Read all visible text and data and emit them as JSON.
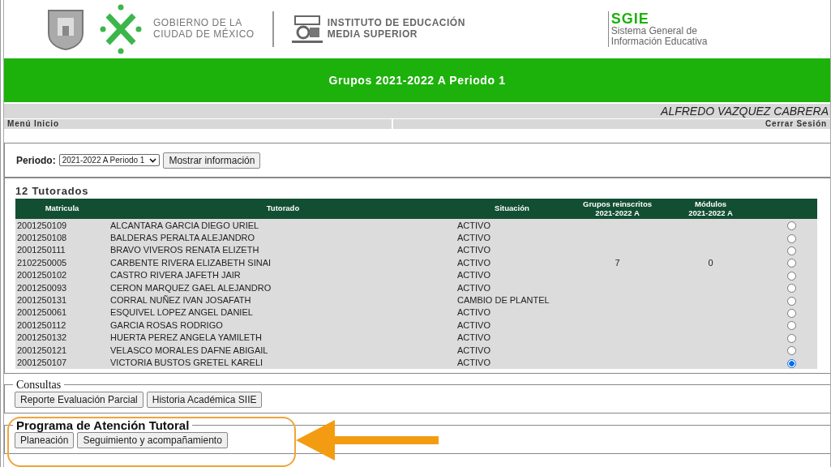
{
  "header": {
    "gov_lines": [
      "GOBIERNO DE LA",
      "CIUDAD DE MÉXICO"
    ],
    "institute_lines": [
      "INSTITUTO DE EDUCACIÓN",
      "MEDIA SUPERIOR"
    ],
    "sgie_title": "SGIE",
    "sgie_lines": [
      "Sistema General de",
      "Información Educativa"
    ]
  },
  "banner": {
    "title": "Grupos 2021-2022 A Periodo 1"
  },
  "user": {
    "name": "ALFREDO VAZQUEZ CABRERA"
  },
  "menu": {
    "left": "Menú Inicio",
    "right": "Cerrar Sesión"
  },
  "period": {
    "label": "Periodo:",
    "value": "2021-2022 A Periodo 1",
    "button": "Mostrar información"
  },
  "tutorados": {
    "title": "12 Tutorados",
    "columns": [
      [
        "Matricula"
      ],
      [
        "Tutorado"
      ],
      [
        "Situación"
      ],
      [
        "Grupos reinscritos",
        "2021-2022 A"
      ],
      [
        "Módulos",
        "2021-2022 A"
      ]
    ],
    "rows": [
      {
        "matricula": "2001250109",
        "tutorado": "ALCANTARA GARCIA DIEGO URIEL",
        "situacion": "ACTIVO",
        "selected": false
      },
      {
        "matricula": "2001250108",
        "tutorado": "BALDERAS PERALTA ALEJANDRO",
        "situacion": "ACTIVO",
        "selected": false
      },
      {
        "matricula": "2001250111",
        "tutorado": "BRAVO VIVEROS RENATA ELIZETH",
        "situacion": "ACTIVO",
        "selected": false
      },
      {
        "matricula": "2102250005",
        "tutorado": "CARBENTE RIVERA ELIZABETH SINAI",
        "situacion": "ACTIVO",
        "grupos": "7",
        "modulos": "0",
        "selected": false
      },
      {
        "matricula": "2001250102",
        "tutorado": "CASTRO RIVERA JAFETH JAIR",
        "situacion": "ACTIVO",
        "selected": false
      },
      {
        "matricula": "2001250093",
        "tutorado": "CERON MARQUEZ GAEL ALEJANDRO",
        "situacion": "ACTIVO",
        "selected": false
      },
      {
        "matricula": "2001250131",
        "tutorado": "CORRAL NUÑEZ IVAN JOSAFATH",
        "situacion": "CAMBIO DE PLANTEL",
        "selected": false
      },
      {
        "matricula": "2001250061",
        "tutorado": "ESQUIVEL LOPEZ ANGEL DANIEL",
        "situacion": "ACTIVO",
        "selected": false
      },
      {
        "matricula": "2001250112",
        "tutorado": "GARCIA ROSAS RODRIGO",
        "situacion": "ACTIVO",
        "selected": false
      },
      {
        "matricula": "2001250132",
        "tutorado": "HUERTA PEREZ ANGELA YAMILETH",
        "situacion": "ACTIVO",
        "selected": false
      },
      {
        "matricula": "2001250121",
        "tutorado": "VELASCO MORALES DAFNE ABIGAIL",
        "situacion": "ACTIVO",
        "selected": false
      },
      {
        "matricula": "2001250107",
        "tutorado": "VICTORIA BUSTOS GRETEL KARELI",
        "situacion": "ACTIVO",
        "selected": true
      }
    ]
  },
  "consultas": {
    "legend": "Consultas",
    "buttons": [
      "Reporte Evaluación Parcial",
      "Historia Académica SIIE"
    ]
  },
  "programa": {
    "legend": "Programa de Atención Tutoral",
    "buttons": [
      "Planeación",
      "Seguimiento y acompañamiento"
    ]
  }
}
